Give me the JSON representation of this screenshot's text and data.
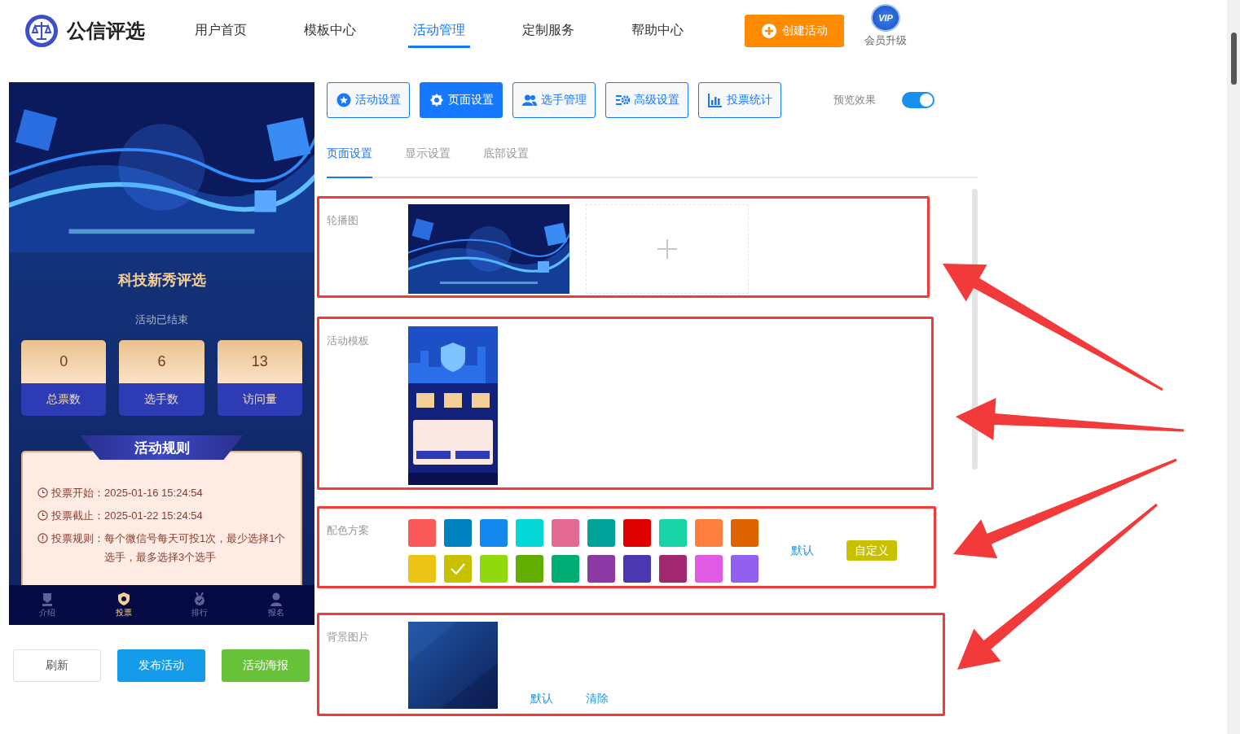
{
  "header": {
    "logo_text": "公信评选",
    "nav": [
      {
        "label": "用户首页",
        "selected": false
      },
      {
        "label": "模板中心",
        "selected": false
      },
      {
        "label": "活动管理",
        "selected": true
      },
      {
        "label": "定制服务",
        "selected": false
      },
      {
        "label": "帮助中心",
        "selected": false
      }
    ],
    "create_button": "创建活动",
    "vip_badge": "VIP",
    "vip_label": "会员升级"
  },
  "preview": {
    "title": "科技新秀评选",
    "status": "活动已结束",
    "stats": [
      {
        "value": "0",
        "label": "总票数"
      },
      {
        "value": "6",
        "label": "选手数"
      },
      {
        "value": "13",
        "label": "访问量"
      }
    ],
    "rules_title": "活动规则",
    "rules": [
      {
        "kind": "clock",
        "label": "投票开始：",
        "value": "2025-01-16 15:24:54"
      },
      {
        "kind": "clock",
        "label": "投票截止：",
        "value": "2025-01-22 15:24:54"
      },
      {
        "kind": "alert",
        "label": "投票规则：",
        "value": "每个微信号每天可投1次，最少选择1个选手，最多选择3个选手"
      }
    ],
    "bottom_nav": [
      {
        "label": "介绍",
        "kind": "trophy",
        "selected": false
      },
      {
        "label": "投票",
        "kind": "shield",
        "selected": true
      },
      {
        "label": "排行",
        "kind": "medal",
        "selected": false
      },
      {
        "label": "报名",
        "kind": "person",
        "selected": false
      }
    ]
  },
  "preview_buttons": [
    {
      "label": "刷新",
      "kind": "plain"
    },
    {
      "label": "发布活动",
      "kind": "primary"
    },
    {
      "label": "活动海报",
      "kind": "success"
    }
  ],
  "toolbar": {
    "tabs": [
      {
        "label": "活动设置",
        "kind": "star",
        "selected": false
      },
      {
        "label": "页面设置",
        "kind": "gear",
        "selected": true
      },
      {
        "label": "选手管理",
        "kind": "users",
        "selected": false
      },
      {
        "label": "高级设置",
        "kind": "sliders",
        "selected": false
      },
      {
        "label": "投票统计",
        "kind": "chart",
        "selected": false
      }
    ],
    "preview_toggle": {
      "label": "预览效果",
      "on": true
    }
  },
  "sub_tabs": [
    {
      "label": "页面设置",
      "selected": true
    },
    {
      "label": "显示设置",
      "selected": false
    },
    {
      "label": "底部设置",
      "selected": false
    }
  ],
  "sections": [
    {
      "kind": "carousel",
      "label": "轮播图"
    },
    {
      "kind": "template",
      "label": "活动模板"
    },
    {
      "kind": "colors",
      "label": "配色方案",
      "swatches": [
        {
          "color": "#f85a5a",
          "selected": false
        },
        {
          "color": "#0082c0",
          "selected": false
        },
        {
          "color": "#1388ee",
          "selected": false
        },
        {
          "color": "#05d7d7",
          "selected": false
        },
        {
          "color": "#e56a93",
          "selected": false
        },
        {
          "color": "#00a39a",
          "selected": false
        },
        {
          "color": "#e10000",
          "selected": false
        },
        {
          "color": "#18d3a6",
          "selected": false
        },
        {
          "color": "#ff7f3f",
          "selected": false
        },
        {
          "color": "#de6400",
          "selected": false
        },
        {
          "color": "#ecc416",
          "selected": false
        },
        {
          "color": "#c8c100",
          "selected": true
        },
        {
          "color": "#92d80f",
          "selected": false
        },
        {
          "color": "#63ac00",
          "selected": false
        },
        {
          "color": "#00ad74",
          "selected": false
        },
        {
          "color": "#8b3aa4",
          "selected": false
        },
        {
          "color": "#4b38b0",
          "selected": false
        },
        {
          "color": "#a1286f",
          "selected": false
        },
        {
          "color": "#e05ae4",
          "selected": false
        },
        {
          "color": "#9160f0",
          "selected": false
        }
      ],
      "links": [
        "默认"
      ],
      "custom_button": "自定义"
    },
    {
      "kind": "background",
      "label": "背景图片",
      "links": [
        "默认",
        "清除"
      ]
    }
  ]
}
